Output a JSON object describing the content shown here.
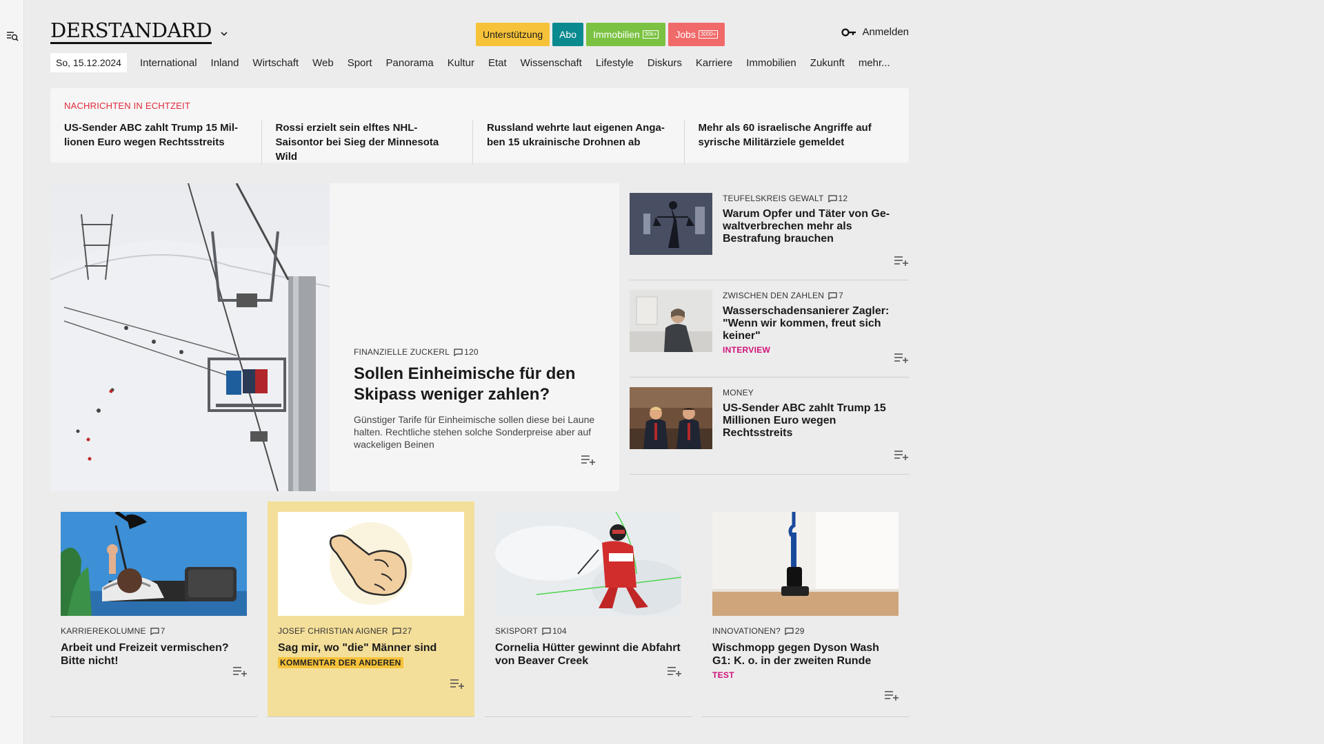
{
  "brand": {
    "logo": "DERSTANDARD"
  },
  "header": {
    "pills": [
      {
        "label": "Unterstützung",
        "bg": "#f6c23a",
        "fg": "#1a1a1a",
        "badge": ""
      },
      {
        "label": "Abo",
        "bg": "#0a8a8f",
        "fg": "#ffffff",
        "badge": ""
      },
      {
        "label": "Immobilien",
        "bg": "#7cc242",
        "fg": "#ffffff",
        "badge": "30k+"
      },
      {
        "label": "Jobs",
        "bg": "#f16a6a",
        "fg": "#ffffff",
        "badge": "3000+"
      }
    ],
    "login": "Anmelden"
  },
  "nav": {
    "date": "So, 15.12.2024",
    "items": [
      "International",
      "Inland",
      "Wirtschaft",
      "Web",
      "Sport",
      "Panorama",
      "Kultur",
      "Etat",
      "Wissenschaft",
      "Lifestyle",
      "Diskurs",
      "Karriere",
      "Immobilien",
      "Zukunft",
      "mehr..."
    ]
  },
  "live": {
    "label": "NACHRICHTEN IN ECHTZEIT",
    "items": [
      "US-Sender ABC zahlt Trump 15 Mil­lionen Euro wegen Rechtsstreits",
      "Rossi erzielt sein elftes NHL-Saisontor bei Sieg der Minnesota Wild",
      "Russland wehrte laut eigenen Anga­ben 15 ukrainische Drohnen ab",
      "Mehr als 60 israelische Angriffe auf syrische Militärziele gemeldet"
    ]
  },
  "lead": {
    "kicker": "FINANZIELLE ZUCKERL",
    "comments": "120",
    "title": "Sollen Einheimische für den Skipass weniger zahlen?",
    "subtitle": "Günstiger Tarife für Einheimische sollen diese bei Laune halten. Rechtliche stehen solche Sonderpreise aber auf wackeligen Beinen"
  },
  "side": [
    {
      "kicker": "TEUFELSKREIS GEWALT",
      "comments": "12",
      "title": "Warum Opfer und Täter von Ge­waltverbrechen mehr als Bestrafung brauchen",
      "tag": ""
    },
    {
      "kicker": "ZWISCHEN DEN ZAHLEN",
      "comments": "7",
      "title": "Wasserschadensanierer Zagler: \"Wenn wir kommen, freut sich keiner\"",
      "tag": "INTERVIEW"
    },
    {
      "kicker": "MONEY",
      "comments": "",
      "title": "US-Sender ABC zahlt Trump 15 Millionen Euro wegen Rechtsstreits",
      "tag": ""
    }
  ],
  "cards": [
    {
      "kicker": "KARRIEREKOLUMNE",
      "comments": "7",
      "title": "Arbeit und Freizeit vermischen? Bitte nicht!",
      "tag": ""
    },
    {
      "kicker": "JOSEF CHRISTIAN AIGNER",
      "comments": "27",
      "title": "Sag mir, wo \"die\" Männer sind",
      "tag": "KOMMENTAR DER ANDEREN"
    },
    {
      "kicker": "SKISPORT",
      "comments": "104",
      "title": "Cornelia Hütter gewinnt die Abfahrt von Beaver Creek",
      "tag": ""
    },
    {
      "kicker": "INNOVATIONEN?",
      "comments": "29",
      "title": "Wischmopp gegen Dyson Wash G1: K. o. in der zweiten Runde",
      "tag": "TEST"
    }
  ],
  "icons": {
    "menu": "search-menu-icon",
    "chevron": "chevron-down-icon",
    "key": "key-icon",
    "comment": "comment-icon",
    "add": "add-to-list-icon"
  },
  "colors": {
    "accent_red": "#e0293a",
    "tag_pink": "#d0127a",
    "highlight": "#f4df9a"
  }
}
